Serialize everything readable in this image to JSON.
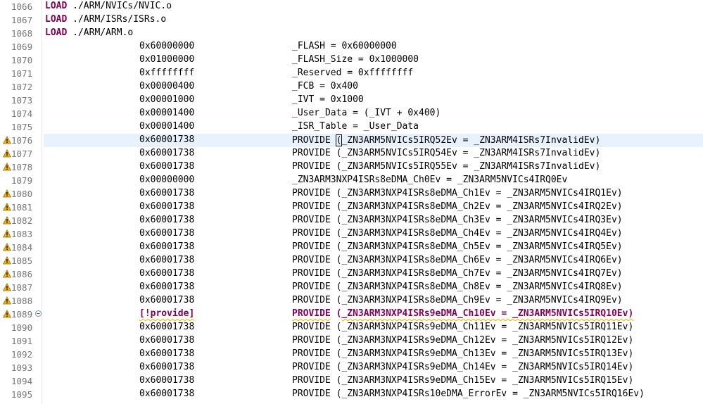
{
  "editor": {
    "lines": [
      {
        "num": "1066",
        "kind": "load",
        "kw": "LOAD",
        "text": "./ARM/NVICs/NVIC.o"
      },
      {
        "num": "1067",
        "kind": "load",
        "kw": "LOAD",
        "text": "./ARM/ISRs/ISRs.o"
      },
      {
        "num": "1068",
        "kind": "load",
        "kw": "LOAD",
        "text": "./ARM/ARM.o"
      },
      {
        "num": "1069",
        "kind": "sym",
        "addr": "0x60000000",
        "expr": "_FLASH = 0x60000000"
      },
      {
        "num": "1070",
        "kind": "sym",
        "addr": "0x01000000",
        "expr": "_FLASH_Size = 0x1000000"
      },
      {
        "num": "1071",
        "kind": "sym",
        "addr": "0xffffffff",
        "expr": "_Reserved = 0xffffffff"
      },
      {
        "num": "1072",
        "kind": "sym",
        "addr": "0x00000400",
        "expr": "_FCB = 0x400"
      },
      {
        "num": "1073",
        "kind": "sym",
        "addr": "0x00001000",
        "expr": "_IVT = 0x1000"
      },
      {
        "num": "1074",
        "kind": "sym",
        "addr": "0x00001400",
        "expr": "_User_Data = (_IVT + 0x400)"
      },
      {
        "num": "1075",
        "kind": "sym",
        "addr": "0x00001400",
        "expr": "_ISR_Table = _User_Data"
      },
      {
        "num": "1076",
        "kind": "prov",
        "warn": true,
        "current": true,
        "addr": "0x60001738",
        "kw": "PROVIDE",
        "pre": " (",
        "body": "_ZN3ARM5NVICs5IRQ52Ev = _ZN3ARM4ISRs7InvalidEv)"
      },
      {
        "num": "1077",
        "kind": "prov",
        "warn": true,
        "addr": "0x60001738",
        "kw": "PROVIDE",
        "pre": " (",
        "body": "_ZN3ARM5NVICs5IRQ54Ev = _ZN3ARM4ISRs7InvalidEv)"
      },
      {
        "num": "1078",
        "kind": "prov",
        "warn": true,
        "addr": "0x60001738",
        "kw": "PROVIDE",
        "pre": " (",
        "body": "_ZN3ARM5NVICs5IRQ55Ev = _ZN3ARM4ISRs7InvalidEv)"
      },
      {
        "num": "1079",
        "kind": "sym",
        "addr": "0x00000000",
        "expr": "_ZN3ARM3NXP4ISRs8eDMA_Ch0Ev = _ZN3ARM5NVICs4IRQ0Ev"
      },
      {
        "num": "1080",
        "kind": "prov",
        "warn": true,
        "addr": "0x60001738",
        "kw": "PROVIDE",
        "pre": " (",
        "body": "_ZN3ARM3NXP4ISRs8eDMA_Ch1Ev = _ZN3ARM5NVICs4IRQ1Ev)"
      },
      {
        "num": "1081",
        "kind": "prov",
        "warn": true,
        "addr": "0x60001738",
        "kw": "PROVIDE",
        "pre": " (",
        "body": "_ZN3ARM3NXP4ISRs8eDMA_Ch2Ev = _ZN3ARM5NVICs4IRQ2Ev)"
      },
      {
        "num": "1082",
        "kind": "prov",
        "warn": true,
        "addr": "0x60001738",
        "kw": "PROVIDE",
        "pre": " (",
        "body": "_ZN3ARM3NXP4ISRs8eDMA_Ch3Ev = _ZN3ARM5NVICs4IRQ3Ev)"
      },
      {
        "num": "1083",
        "kind": "prov",
        "warn": true,
        "addr": "0x60001738",
        "kw": "PROVIDE",
        "pre": " (",
        "body": "_ZN3ARM3NXP4ISRs8eDMA_Ch4Ev = _ZN3ARM5NVICs4IRQ4Ev)"
      },
      {
        "num": "1084",
        "kind": "prov",
        "warn": true,
        "addr": "0x60001738",
        "kw": "PROVIDE",
        "pre": " (",
        "body": "_ZN3ARM3NXP4ISRs8eDMA_Ch5Ev = _ZN3ARM5NVICs4IRQ5Ev)"
      },
      {
        "num": "1085",
        "kind": "prov",
        "warn": true,
        "addr": "0x60001738",
        "kw": "PROVIDE",
        "pre": " (",
        "body": "_ZN3ARM3NXP4ISRs8eDMA_Ch6Ev = _ZN3ARM5NVICs4IRQ6Ev)"
      },
      {
        "num": "1086",
        "kind": "prov",
        "warn": true,
        "addr": "0x60001738",
        "kw": "PROVIDE",
        "pre": " (",
        "body": "_ZN3ARM3NXP4ISRs8eDMA_Ch7Ev = _ZN3ARM5NVICs4IRQ7Ev)"
      },
      {
        "num": "1087",
        "kind": "prov",
        "warn": true,
        "addr": "0x60001738",
        "kw": "PROVIDE",
        "pre": " (",
        "body": "_ZN3ARM3NXP4ISRs8eDMA_Ch8Ev = _ZN3ARM5NVICs4IRQ8Ev)"
      },
      {
        "num": "1088",
        "kind": "prov",
        "warn": true,
        "addr": "0x60001738",
        "kw": "PROVIDE",
        "pre": " (",
        "body": "_ZN3ARM3NXP4ISRs8eDMA_Ch9Ev = _ZN3ARM5NVICs4IRQ9Ev)"
      },
      {
        "num": "1089",
        "kind": "nprov",
        "warn": true,
        "fold": true,
        "addr": "[!provide]",
        "kw": "PROVIDE",
        "pre": " (",
        "body": "_ZN3ARM3NXP4ISRs9eDMA_Ch10Ev = _ZN3ARM5NVICs5IRQ10Ev)"
      },
      {
        "num": "1090",
        "kind": "prov",
        "addr": "0x60001738",
        "kw": "PROVIDE",
        "pre": " (",
        "body": "_ZN3ARM3NXP4ISRs9eDMA_Ch11Ev = _ZN3ARM5NVICs5IRQ11Ev)"
      },
      {
        "num": "1091",
        "kind": "prov",
        "addr": "0x60001738",
        "kw": "PROVIDE",
        "pre": " (",
        "body": "_ZN3ARM3NXP4ISRs9eDMA_Ch12Ev = _ZN3ARM5NVICs5IRQ12Ev)"
      },
      {
        "num": "1092",
        "kind": "prov",
        "addr": "0x60001738",
        "kw": "PROVIDE",
        "pre": " (",
        "body": "_ZN3ARM3NXP4ISRs9eDMA_Ch13Ev = _ZN3ARM5NVICs5IRQ13Ev)"
      },
      {
        "num": "1093",
        "kind": "prov",
        "addr": "0x60001738",
        "kw": "PROVIDE",
        "pre": " (",
        "body": "_ZN3ARM3NXP4ISRs9eDMA_Ch14Ev = _ZN3ARM5NVICs5IRQ14Ev)"
      },
      {
        "num": "1094",
        "kind": "prov",
        "addr": "0x60001738",
        "kw": "PROVIDE",
        "pre": " (",
        "body": "_ZN3ARM3NXP4ISRs9eDMA_Ch15Ev = _ZN3ARM5NVICs5IRQ15Ev)"
      },
      {
        "num": "1095",
        "kind": "prov",
        "addr": "0x60001738",
        "kw": "PROVIDE",
        "pre": " (",
        "body": "_ZN3ARM3NXP4ISRs10eDMA_ErrorEv = _ZN3ARM5NVICs5IRQ16Ev)"
      }
    ]
  },
  "icons": {
    "warning": "warning-icon",
    "fold": "fold-collapse-icon"
  },
  "colors": {
    "keyword": "#7f0055",
    "current_line": "#e8f2fe",
    "warning": "#f5b400",
    "line_number": "#787878"
  }
}
